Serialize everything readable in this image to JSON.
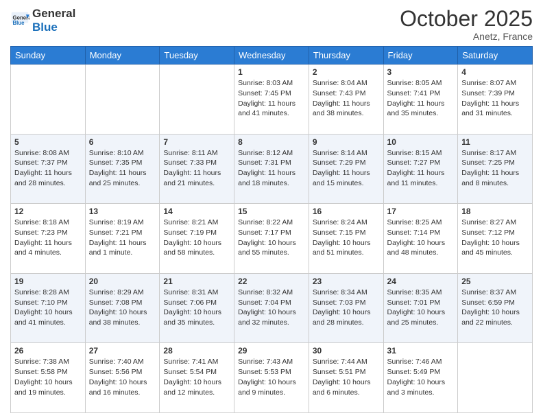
{
  "header": {
    "logo_line1": "General",
    "logo_line2": "Blue",
    "month": "October 2025",
    "location": "Anetz, France"
  },
  "weekdays": [
    "Sunday",
    "Monday",
    "Tuesday",
    "Wednesday",
    "Thursday",
    "Friday",
    "Saturday"
  ],
  "weeks": [
    [
      {
        "day": "",
        "info": ""
      },
      {
        "day": "",
        "info": ""
      },
      {
        "day": "",
        "info": ""
      },
      {
        "day": "1",
        "info": "Sunrise: 8:03 AM\nSunset: 7:45 PM\nDaylight: 11 hours\nand 41 minutes."
      },
      {
        "day": "2",
        "info": "Sunrise: 8:04 AM\nSunset: 7:43 PM\nDaylight: 11 hours\nand 38 minutes."
      },
      {
        "day": "3",
        "info": "Sunrise: 8:05 AM\nSunset: 7:41 PM\nDaylight: 11 hours\nand 35 minutes."
      },
      {
        "day": "4",
        "info": "Sunrise: 8:07 AM\nSunset: 7:39 PM\nDaylight: 11 hours\nand 31 minutes."
      }
    ],
    [
      {
        "day": "5",
        "info": "Sunrise: 8:08 AM\nSunset: 7:37 PM\nDaylight: 11 hours\nand 28 minutes."
      },
      {
        "day": "6",
        "info": "Sunrise: 8:10 AM\nSunset: 7:35 PM\nDaylight: 11 hours\nand 25 minutes."
      },
      {
        "day": "7",
        "info": "Sunrise: 8:11 AM\nSunset: 7:33 PM\nDaylight: 11 hours\nand 21 minutes."
      },
      {
        "day": "8",
        "info": "Sunrise: 8:12 AM\nSunset: 7:31 PM\nDaylight: 11 hours\nand 18 minutes."
      },
      {
        "day": "9",
        "info": "Sunrise: 8:14 AM\nSunset: 7:29 PM\nDaylight: 11 hours\nand 15 minutes."
      },
      {
        "day": "10",
        "info": "Sunrise: 8:15 AM\nSunset: 7:27 PM\nDaylight: 11 hours\nand 11 minutes."
      },
      {
        "day": "11",
        "info": "Sunrise: 8:17 AM\nSunset: 7:25 PM\nDaylight: 11 hours\nand 8 minutes."
      }
    ],
    [
      {
        "day": "12",
        "info": "Sunrise: 8:18 AM\nSunset: 7:23 PM\nDaylight: 11 hours\nand 4 minutes."
      },
      {
        "day": "13",
        "info": "Sunrise: 8:19 AM\nSunset: 7:21 PM\nDaylight: 11 hours\nand 1 minute."
      },
      {
        "day": "14",
        "info": "Sunrise: 8:21 AM\nSunset: 7:19 PM\nDaylight: 10 hours\nand 58 minutes."
      },
      {
        "day": "15",
        "info": "Sunrise: 8:22 AM\nSunset: 7:17 PM\nDaylight: 10 hours\nand 55 minutes."
      },
      {
        "day": "16",
        "info": "Sunrise: 8:24 AM\nSunset: 7:15 PM\nDaylight: 10 hours\nand 51 minutes."
      },
      {
        "day": "17",
        "info": "Sunrise: 8:25 AM\nSunset: 7:14 PM\nDaylight: 10 hours\nand 48 minutes."
      },
      {
        "day": "18",
        "info": "Sunrise: 8:27 AM\nSunset: 7:12 PM\nDaylight: 10 hours\nand 45 minutes."
      }
    ],
    [
      {
        "day": "19",
        "info": "Sunrise: 8:28 AM\nSunset: 7:10 PM\nDaylight: 10 hours\nand 41 minutes."
      },
      {
        "day": "20",
        "info": "Sunrise: 8:29 AM\nSunset: 7:08 PM\nDaylight: 10 hours\nand 38 minutes."
      },
      {
        "day": "21",
        "info": "Sunrise: 8:31 AM\nSunset: 7:06 PM\nDaylight: 10 hours\nand 35 minutes."
      },
      {
        "day": "22",
        "info": "Sunrise: 8:32 AM\nSunset: 7:04 PM\nDaylight: 10 hours\nand 32 minutes."
      },
      {
        "day": "23",
        "info": "Sunrise: 8:34 AM\nSunset: 7:03 PM\nDaylight: 10 hours\nand 28 minutes."
      },
      {
        "day": "24",
        "info": "Sunrise: 8:35 AM\nSunset: 7:01 PM\nDaylight: 10 hours\nand 25 minutes."
      },
      {
        "day": "25",
        "info": "Sunrise: 8:37 AM\nSunset: 6:59 PM\nDaylight: 10 hours\nand 22 minutes."
      }
    ],
    [
      {
        "day": "26",
        "info": "Sunrise: 7:38 AM\nSunset: 5:58 PM\nDaylight: 10 hours\nand 19 minutes."
      },
      {
        "day": "27",
        "info": "Sunrise: 7:40 AM\nSunset: 5:56 PM\nDaylight: 10 hours\nand 16 minutes."
      },
      {
        "day": "28",
        "info": "Sunrise: 7:41 AM\nSunset: 5:54 PM\nDaylight: 10 hours\nand 12 minutes."
      },
      {
        "day": "29",
        "info": "Sunrise: 7:43 AM\nSunset: 5:53 PM\nDaylight: 10 hours\nand 9 minutes."
      },
      {
        "day": "30",
        "info": "Sunrise: 7:44 AM\nSunset: 5:51 PM\nDaylight: 10 hours\nand 6 minutes."
      },
      {
        "day": "31",
        "info": "Sunrise: 7:46 AM\nSunset: 5:49 PM\nDaylight: 10 hours\nand 3 minutes."
      },
      {
        "day": "",
        "info": ""
      }
    ]
  ]
}
